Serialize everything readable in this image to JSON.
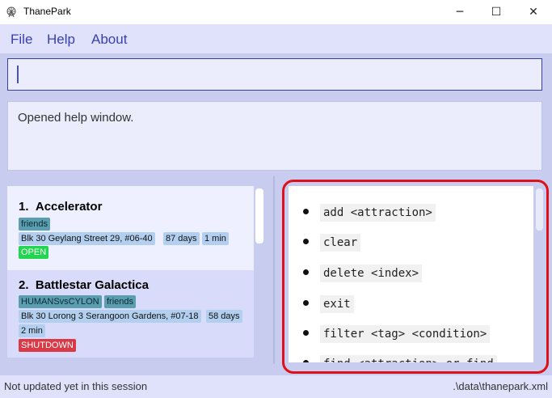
{
  "window": {
    "title": "ThanePark",
    "minimize_glyph": "─",
    "maximize_glyph": "☐",
    "close_glyph": "✕",
    "icon": "ferris-wheel-icon"
  },
  "menu": {
    "file": "File",
    "help": "Help",
    "about": "About"
  },
  "command": {
    "value": "",
    "placeholder": ""
  },
  "result": {
    "text": "Opened help window."
  },
  "attractions": [
    {
      "index": "1.",
      "name": "Accelerator",
      "tags": [
        "friends"
      ],
      "address": "Blk 30 Geylang Street 29, #06-40",
      "days": "87 days",
      "wait": "1 min",
      "status": "OPEN"
    },
    {
      "index": "2.",
      "name": "Battlestar Galactica",
      "tags": [
        "HUMANSvsCYLON",
        "friends"
      ],
      "address": "Blk 30 Lorong 3 Serangoon Gardens, #07-18",
      "days": "58 days",
      "wait": "2 min",
      "status": "SHUTDOWN"
    }
  ],
  "help": {
    "commands": [
      "add <attraction>",
      "clear",
      "delete <index>",
      "exit",
      "filter <tag> <condition>",
      "find <attraction> or find"
    ]
  },
  "status": {
    "left": "Not updated yet in this session",
    "right": ".\\data\\thanepark.xml"
  },
  "colors": {
    "accent_blue": "#3a3fb0",
    "highlight_red": "#e0101a",
    "open_green": "#22d650",
    "shutdown_red": "#d83a46"
  }
}
